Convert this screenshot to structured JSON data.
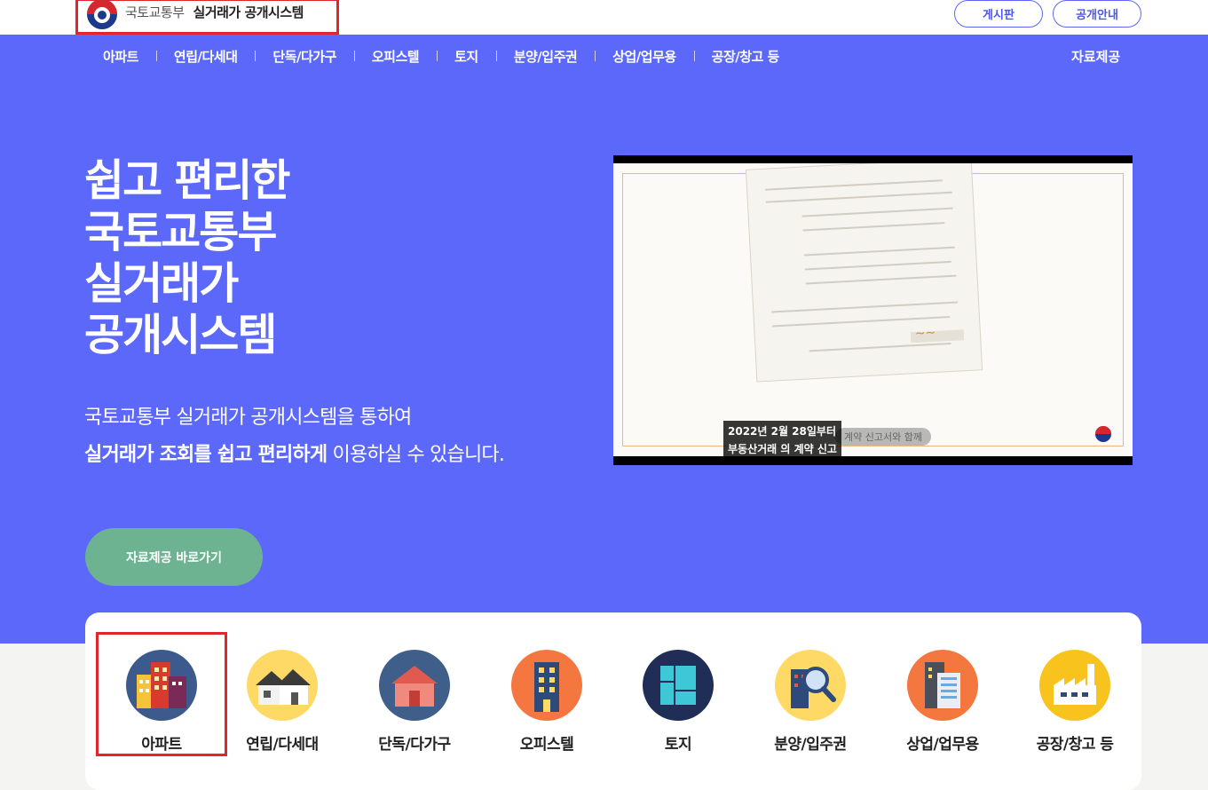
{
  "header": {
    "org": "국토교통부",
    "title": "실거래가 공개시스템",
    "board_label": "게시판",
    "guide_label": "공개안내"
  },
  "nav": {
    "items": [
      "아파트",
      "연립/다세대",
      "단독/다가구",
      "오피스텔",
      "토지",
      "분양/입주권",
      "상업/업무용",
      "공장/창고 등"
    ],
    "data_label": "자료제공"
  },
  "hero": {
    "headline": [
      "쉽고 편리한",
      "국토교통부",
      "실거래가",
      "공개시스템"
    ],
    "sub_line1": "국토교통부 실거래가 공개시스템을 통하여",
    "sub_line2_bold": "실거래가 조회를 쉽고 편리하게",
    "sub_line2_rest": " 이용하실 수 있습니다.",
    "cta_label": "자료제공 바로가기",
    "video_caption_line1": "2022년 2월 28일부터",
    "video_caption_line2": "부동산거래 의 계약 신고",
    "video_caption_ghost": "계약 신고서와 함께"
  },
  "categories": [
    {
      "label": "아파트",
      "icon": "apartment-icon",
      "color": "#3d5a8c",
      "selected": true
    },
    {
      "label": "연립/다세대",
      "icon": "row-house-icon",
      "color": "#ffd966"
    },
    {
      "label": "단독/다가구",
      "icon": "detached-house-icon",
      "color": "#3f5e8a"
    },
    {
      "label": "오피스텔",
      "icon": "officetel-icon",
      "color": "#f4773f"
    },
    {
      "label": "토지",
      "icon": "land-icon",
      "color": "#1f2d57"
    },
    {
      "label": "분양/입주권",
      "icon": "presale-search-icon",
      "color": "#ffd966"
    },
    {
      "label": "상업/업무용",
      "icon": "commercial-building-icon",
      "color": "#f4773f"
    },
    {
      "label": "공장/창고 등",
      "icon": "factory-icon",
      "color": "#f7c31c"
    }
  ],
  "colors": {
    "hero_bg": "#5b68fa",
    "cta_bg": "#6db392",
    "highlight_border": "#e0262b"
  }
}
